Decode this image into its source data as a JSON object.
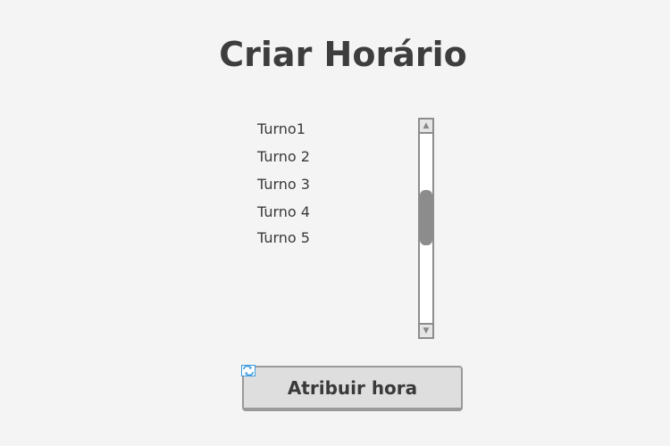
{
  "page": {
    "title": "Criar Horário"
  },
  "shift_list": {
    "items": [
      "Turno1",
      "Turno 2",
      "Turno 3",
      "Turno 4",
      "Turno 5"
    ],
    "scroll_position": 0.42
  },
  "actions": {
    "assign_label": "Atribuir hora"
  },
  "icons": {
    "scroll_up": "scroll-up-arrow-icon",
    "scroll_down": "scroll-down-arrow-icon",
    "refresh": "refresh-icon"
  },
  "colors": {
    "background": "#f4f4f4",
    "text": "#3a3a3a",
    "button_face": "#dedede",
    "scroll_thumb": "#8c8c8c",
    "refresh_icon": "#3b9ae1"
  }
}
